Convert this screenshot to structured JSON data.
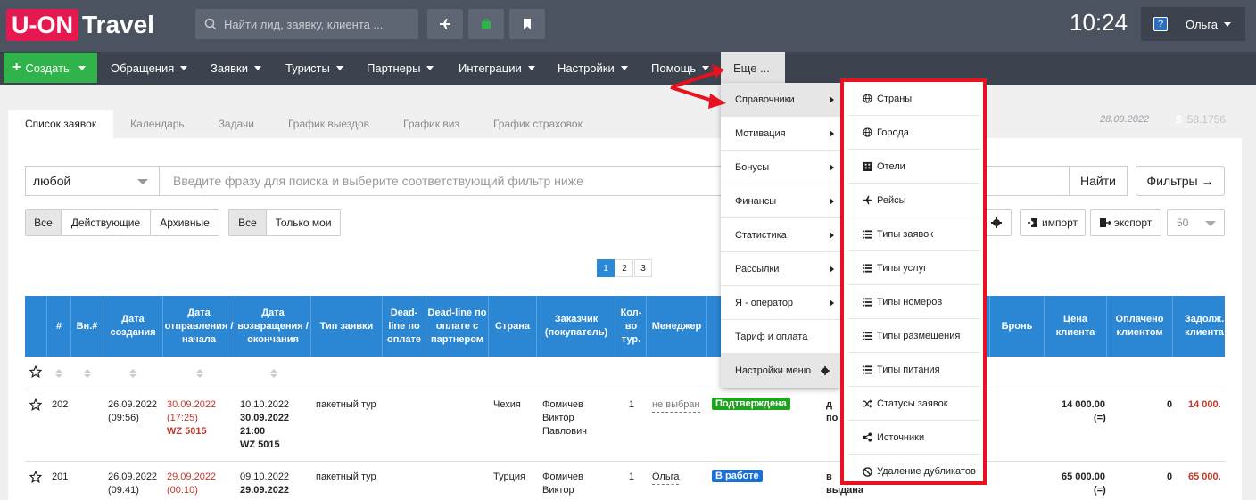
{
  "topbar": {
    "logo_box": "U-ON",
    "logo_text": "Travel",
    "search_placeholder": "Найти лид, заявку, клиента ...",
    "time": "10:24",
    "user": "Ольга"
  },
  "nav": {
    "create": "Создать",
    "items": [
      "Обращения",
      "Заявки",
      "Туристы",
      "Партнеры",
      "Интеграции",
      "Настройки",
      "Помощь"
    ],
    "more": "Еще ...",
    "date": "28.09.2022",
    "rate": "58.1756",
    "currency": "$"
  },
  "tabs": [
    "Список заявок",
    "Календарь",
    "Задачи",
    "График выездов",
    "График виз",
    "График страховок"
  ],
  "filter": {
    "select": "любой",
    "placeholder": "Введите фразу для поиска и выберите соответствующий фильтр ниже",
    "find": "Найти",
    "filters": "Фильтры →"
  },
  "status_buttons": [
    "Все",
    "Действующие",
    "Архивные"
  ],
  "owner_buttons": [
    "Все",
    "Только мои"
  ],
  "actions": {
    "import": "импорт",
    "export": "экспорт",
    "page_size": "50"
  },
  "pages": [
    "1",
    "2",
    "3"
  ],
  "columns": [
    "#",
    "Вн.#",
    "Дата создания",
    "Дата отправления / начала",
    "Дата возвращения / окончания",
    "Тип заявки",
    "Dead-line по оплате",
    "Dead-line по оплате с партнером",
    "Страна",
    "Заказчик (покупатель)",
    "Кол-во тур.",
    "Менеджер",
    "",
    "",
    "Бронь",
    "Цена клиента",
    "Оплачено клиентом",
    "Задолж. клиента"
  ],
  "rows": [
    {
      "num": "202",
      "created": "26.09.2022",
      "created_time": "(09:56)",
      "dep": "30.09.2022",
      "dep_time": "(17:25)",
      "dep_flight": "WZ 5015",
      "ret": "10.10.2022",
      "ret2": "30.09.2022",
      "ret2_time": "21:00",
      "ret_flight": "WZ 5015",
      "type": "пакетный тур",
      "country": "Чехия",
      "customer": [
        "Фомичев",
        "Виктор",
        "Павлович"
      ],
      "qty": "1",
      "manager": "не выбран",
      "status": "Подтверждена",
      "status_color": "#1ea31e",
      "doc": "д",
      "doc2": "по",
      "price": "14 000.00",
      "price_sign": "(=)",
      "paid": "0",
      "debt": "14 000."
    },
    {
      "num": "201",
      "created": "26.09.2022",
      "created_time": "(09:41)",
      "dep": "29.09.2022",
      "dep_time": "(00:10)",
      "dep_flight": "",
      "ret": "09.10.2022",
      "ret2": "29.09.2022",
      "ret2_time": "",
      "ret_flight": "",
      "type": "пакетный тур",
      "country": "Турция",
      "customer": [
        "Фомичев",
        "Виктор",
        ""
      ],
      "qty": "1",
      "manager": "Ольга",
      "status": "В работе",
      "status_color": "#1a6fd8",
      "doc": "в",
      "doc2": "выдана",
      "price": "65 000.00",
      "price_sign": "(=)",
      "paid": "0",
      "debt": "65 000."
    }
  ],
  "menu1": [
    "Справочники",
    "Мотивация",
    "Бонусы",
    "Финансы",
    "Статистика",
    "Рассылки",
    "Я - оператор",
    "Тариф и оплата",
    "Настройки меню"
  ],
  "menu2": [
    "Страны",
    "Города",
    "Отели",
    "Рейсы",
    "Типы заявок",
    "Типы услуг",
    "Типы номеров",
    "Типы размещения",
    "Типы питания",
    "Статусы заявок",
    "Источники",
    "Удаление дубликатов"
  ]
}
